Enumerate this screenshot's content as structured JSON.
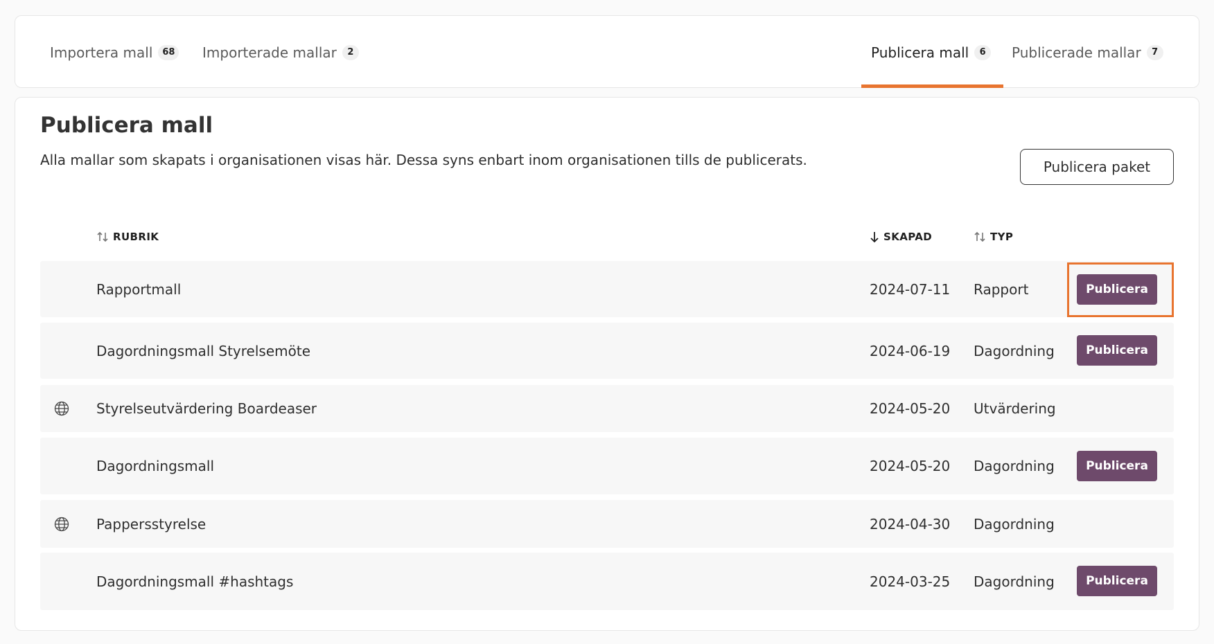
{
  "tabs": [
    {
      "label": "Importera mall",
      "count": "68"
    },
    {
      "label": "Importerade mallar",
      "count": "2"
    },
    {
      "label": "Publicera mall",
      "count": "6"
    },
    {
      "label": "Publicerade mallar",
      "count": "7"
    }
  ],
  "page": {
    "title": "Publicera mall",
    "description": "Alla mallar som skapats i organisationen visas här. Dessa syns enbart inom organisationen tills de publicerats.",
    "package_button": "Publicera paket"
  },
  "table": {
    "columns": {
      "title": "RUBRIK",
      "created": "SKAPAD",
      "type": "TYP"
    },
    "publish_label": "Publicera",
    "rows": [
      {
        "title": "Rapportmall",
        "created": "2024-07-11",
        "type": "Rapport",
        "globe": false,
        "publish": true
      },
      {
        "title": "Dagordningsmall Styrelsemöte",
        "created": "2024-06-19",
        "type": "Dagordning",
        "globe": false,
        "publish": true
      },
      {
        "title": "Styrelseutvärdering Boardeaser",
        "created": "2024-05-20",
        "type": "Utvärdering",
        "globe": true,
        "publish": false
      },
      {
        "title": "Dagordningsmall",
        "created": "2024-05-20",
        "type": "Dagordning",
        "globe": false,
        "publish": true
      },
      {
        "title": "Pappersstyrelse",
        "created": "2024-04-30",
        "type": "Dagordning",
        "globe": true,
        "publish": false
      },
      {
        "title": "Dagordningsmall #hashtags",
        "created": "2024-03-25",
        "type": "Dagordning",
        "globe": false,
        "publish": true
      }
    ]
  },
  "colors": {
    "accent": "#e8742f",
    "publish_button": "#6e4a6b",
    "row_background": "#f7f7f7"
  },
  "icons": {
    "sort_both": "sort-arrows-icon",
    "sort_desc": "arrow-down-icon",
    "globe": "globe-icon"
  }
}
